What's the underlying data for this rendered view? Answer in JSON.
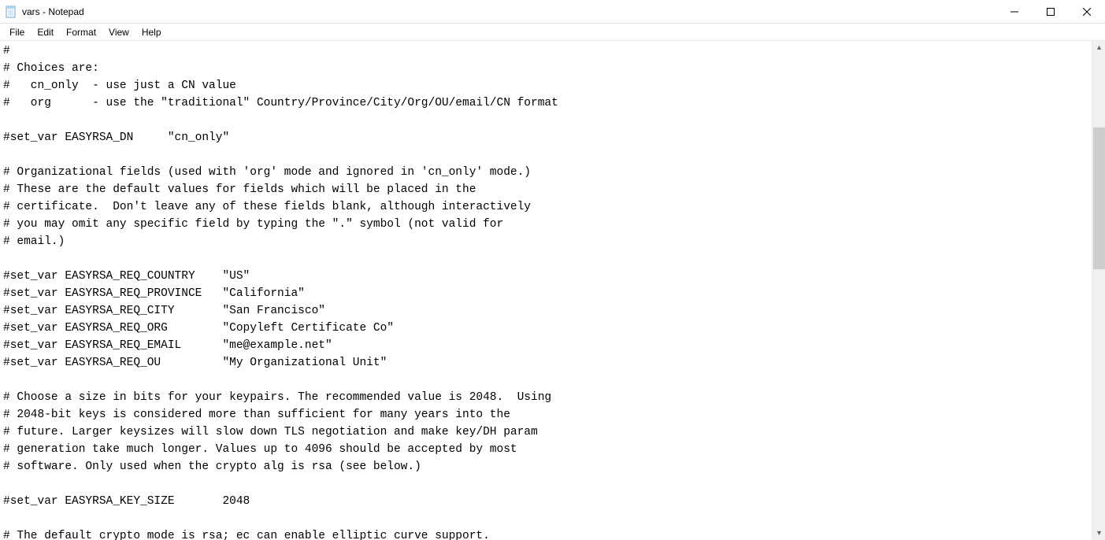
{
  "title": "vars - Notepad",
  "menu": {
    "file": "File",
    "edit": "Edit",
    "format": "Format",
    "view": "View",
    "help": "Help"
  },
  "editor_content": "#\n# Choices are:\n#   cn_only  - use just a CN value\n#   org      - use the \"traditional\" Country/Province/City/Org/OU/email/CN format\n\n#set_var EASYRSA_DN     \"cn_only\"\n\n# Organizational fields (used with 'org' mode and ignored in 'cn_only' mode.)\n# These are the default values for fields which will be placed in the\n# certificate.  Don't leave any of these fields blank, although interactively\n# you may omit any specific field by typing the \".\" symbol (not valid for\n# email.)\n\n#set_var EASYRSA_REQ_COUNTRY    \"US\"\n#set_var EASYRSA_REQ_PROVINCE   \"California\"\n#set_var EASYRSA_REQ_CITY       \"San Francisco\"\n#set_var EASYRSA_REQ_ORG        \"Copyleft Certificate Co\"\n#set_var EASYRSA_REQ_EMAIL      \"me@example.net\"\n#set_var EASYRSA_REQ_OU         \"My Organizational Unit\"\n\n# Choose a size in bits for your keypairs. The recommended value is 2048.  Using\n# 2048-bit keys is considered more than sufficient for many years into the\n# future. Larger keysizes will slow down TLS negotiation and make key/DH param\n# generation take much longer. Values up to 4096 should be accepted by most\n# software. Only used when the crypto alg is rsa (see below.)\n\n#set_var EASYRSA_KEY_SIZE       2048\n\n# The default crypto mode is rsa; ec can enable elliptic curve support."
}
